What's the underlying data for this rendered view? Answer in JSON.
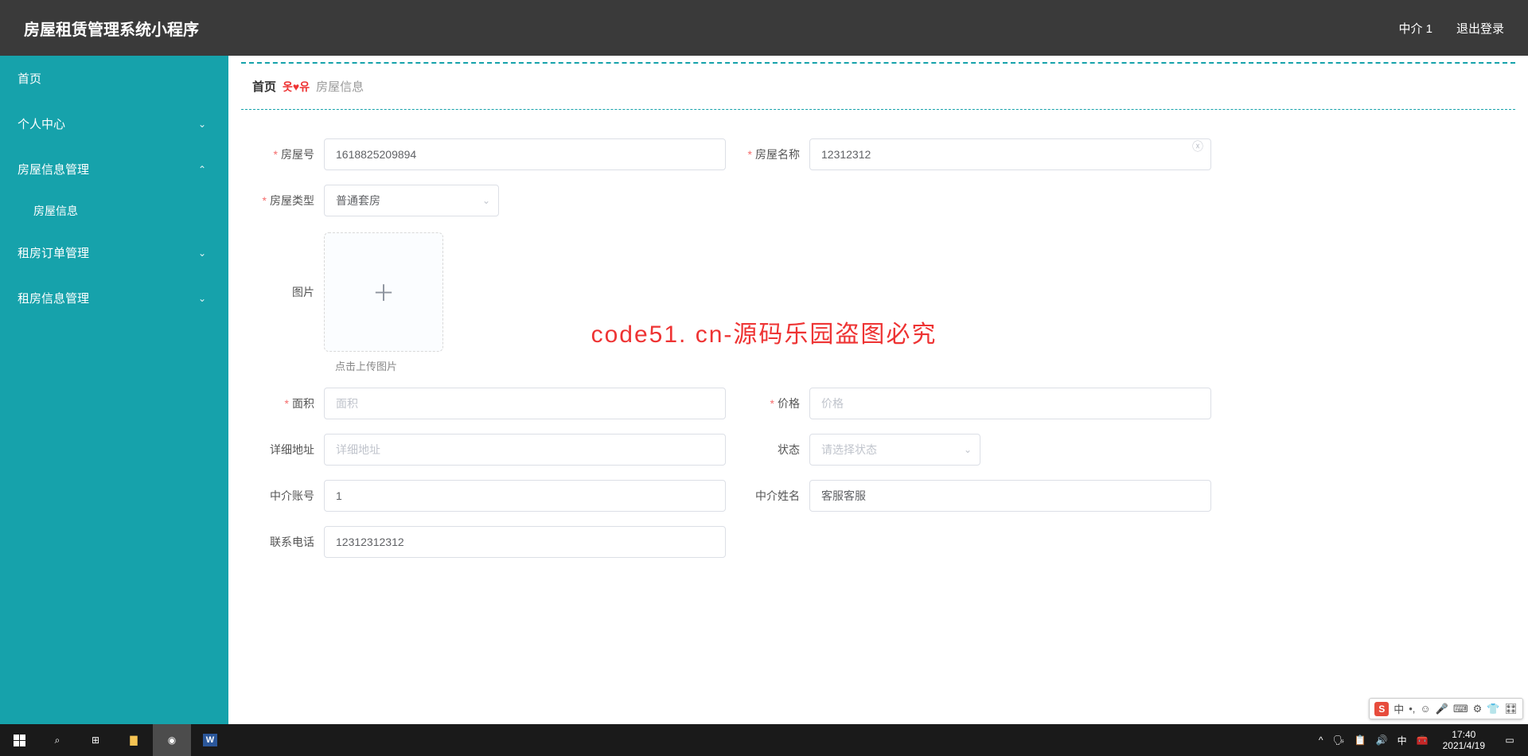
{
  "header": {
    "title": "房屋租赁管理系统小程序",
    "user": "中介 1",
    "logout": "退出登录"
  },
  "sidebar": {
    "items": [
      {
        "label": "首页",
        "expandable": false
      },
      {
        "label": "个人中心",
        "expandable": true,
        "open": false
      },
      {
        "label": "房屋信息管理",
        "expandable": true,
        "open": true,
        "children": [
          {
            "label": "房屋信息"
          }
        ]
      },
      {
        "label": "租房订单管理",
        "expandable": true,
        "open": false
      },
      {
        "label": "租房信息管理",
        "expandable": true,
        "open": false
      }
    ]
  },
  "breadcrumb": {
    "home": "首页",
    "sep": "옷♥유",
    "current": "房屋信息"
  },
  "form": {
    "house_no": {
      "label": "房屋号",
      "value": "1618825209894"
    },
    "house_name": {
      "label": "房屋名称",
      "value": "12312312"
    },
    "house_type": {
      "label": "房屋类型",
      "value": "普通套房"
    },
    "image": {
      "label": "图片",
      "hint": "点击上传图片"
    },
    "area": {
      "label": "面积",
      "placeholder": "面积",
      "value": ""
    },
    "price": {
      "label": "价格",
      "placeholder": "价格",
      "value": ""
    },
    "address": {
      "label": "详细地址",
      "placeholder": "详细地址",
      "value": ""
    },
    "status": {
      "label": "状态",
      "placeholder": "请选择状态",
      "value": ""
    },
    "agent_account": {
      "label": "中介账号",
      "value": "1"
    },
    "agent_name": {
      "label": "中介姓名",
      "value": "客服客服"
    },
    "phone": {
      "label": "联系电话",
      "value": "12312312312"
    }
  },
  "watermark": {
    "text": "code51.cn",
    "big": "code51. cn-源码乐园盗图必究"
  },
  "taskbar": {
    "time": "17:40",
    "date": "2021/4/19",
    "tray": [
      "^",
      "🗣",
      "📋",
      "🔊",
      "中",
      "🧰"
    ]
  },
  "ime": {
    "s": "S",
    "items": [
      "中",
      "•,",
      "☺",
      "🎤",
      "⌨",
      "⚙",
      "👕",
      "🎛"
    ]
  }
}
